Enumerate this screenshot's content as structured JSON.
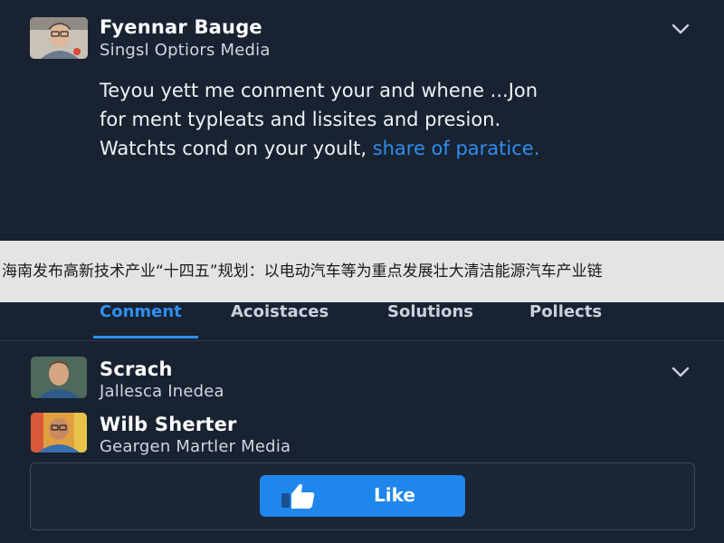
{
  "post": {
    "author": {
      "name": "Fyennar Bauge",
      "org": "Singsl Optiors Media",
      "avatar_icon": "person-avatar"
    },
    "text_lines": [
      "Teyou yett me conment your and whene ...Jon",
      "for ment typleats and lissites and presion."
    ],
    "text_line3": "Watchts cond on your yoult, ",
    "link_text": "share of paratice.",
    "menu_icon": "chevron-down-icon"
  },
  "banner": {
    "text": "海南发布高新技术产业“十四五”规划：以电动汽车等为重点发展壮大清洁能源汽车产业链"
  },
  "tabs": [
    {
      "label": "Conment",
      "active": true
    },
    {
      "label": "Acoistaces",
      "active": false
    },
    {
      "label": "Solutions",
      "active": false
    },
    {
      "label": "Pollects",
      "active": false
    }
  ],
  "comments": [
    {
      "name": "Scrach",
      "org": "Jallesca Inedea",
      "avatar_icon": "person-avatar"
    },
    {
      "name": "Wilb Sherter",
      "org": "Geargen Martler Media",
      "avatar_icon": "person-avatar"
    }
  ],
  "like_button": {
    "label": "Like",
    "icon": "thumbs-up-icon"
  },
  "colors": {
    "background": "#182231",
    "accent": "#2f8ef0",
    "like_button": "#1f86ec",
    "banner_bg": "#e4e4e4"
  }
}
